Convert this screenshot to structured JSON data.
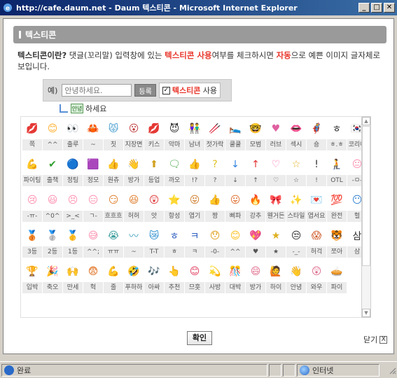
{
  "window": {
    "title": "http://cafe.daum.net - Daum 텍스티콘 - Microsoft Internet Explorer",
    "min_label": "_",
    "max_label": "□",
    "close_label": "✕"
  },
  "panel": {
    "title": "텍스티콘",
    "intro_q": "텍스티콘이란?",
    "intro_1": " 댓글(꼬리말) 입력창에 있는 ",
    "intro_r1": "텍스티콘 사용",
    "intro_2": "여부를 체크하시면 ",
    "intro_r2": "자동",
    "intro_3": "으로 예쁜 이미지 글자체로 보입니다."
  },
  "demo": {
    "example_label": "예)",
    "input_value": "안녕하세요.",
    "register_label": "등록",
    "checkbox_mark": "✓",
    "use_red": "텍스티콘",
    "use_rest": " 사용",
    "preview_pic": "안녕",
    "preview_text": "하세요"
  },
  "emoticons": [
    {
      "label": "쪽",
      "icon": "💋",
      "color": "#ff6fa0"
    },
    {
      "label": "^^",
      "icon": "😊",
      "color": "#ffb030"
    },
    {
      "label": "출루",
      "icon": "👀",
      "color": "#8a6a2a"
    },
    {
      "label": "~",
      "icon": "🦀",
      "color": "#e0502a"
    },
    {
      "label": "칫",
      "icon": "😾",
      "color": "#4aa0d0"
    },
    {
      "label": "지장면",
      "icon": "😮",
      "color": "#c04040"
    },
    {
      "label": "키스",
      "icon": "💋",
      "color": "#e02020"
    },
    {
      "label": "악마",
      "icon": "😈",
      "color": "#333333"
    },
    {
      "label": "남녀",
      "icon": "👫",
      "color": "#d07030"
    },
    {
      "label": "젓가락",
      "icon": "🥢",
      "color": "#c08040"
    },
    {
      "label": "쿨쿨",
      "icon": "🛌",
      "color": "#e0a060"
    },
    {
      "label": "모범",
      "icon": "🤓",
      "color": "#b07050"
    },
    {
      "label": "러브",
      "icon": "♥",
      "color": "#e060a0"
    },
    {
      "label": "섹시",
      "icon": "👄",
      "color": "#e02040"
    },
    {
      "label": "숑",
      "icon": "🦸",
      "color": "#c03030"
    },
    {
      "label": "ㅎ.ㅎ",
      "icon": "ㅎ",
      "color": "#333333"
    },
    {
      "label": "코리아",
      "icon": "🇰🇷",
      "color": "#2050c0"
    },
    {
      "label": "파이팅",
      "icon": "💪",
      "color": "#d04080"
    },
    {
      "label": "출책",
      "icon": "✔",
      "color": "#30a030"
    },
    {
      "label": "정팅",
      "icon": "🔵",
      "color": "#3070d0"
    },
    {
      "label": "정모",
      "icon": "🟪",
      "color": "#8040c0"
    },
    {
      "label": "원츄",
      "icon": "👍",
      "color": "#e04040"
    },
    {
      "label": "방가",
      "icon": "👋",
      "color": "#e07090"
    },
    {
      "label": "등업",
      "icon": "⬆",
      "color": "#d0a020"
    },
    {
      "label": "까오",
      "icon": "🗨",
      "color": "#40a040"
    },
    {
      "label": "!?",
      "icon": "👍",
      "color": "#e0a020"
    },
    {
      "label": "?",
      "icon": "?",
      "color": "#e0c020"
    },
    {
      "label": "↓",
      "icon": "↓",
      "color": "#3080e0"
    },
    {
      "label": "↑",
      "icon": "↑",
      "color": "#e03030"
    },
    {
      "label": "♡",
      "icon": "♡",
      "color": "#ff70b0"
    },
    {
      "label": "☆",
      "icon": "☆",
      "color": "#e0b020"
    },
    {
      "label": "!",
      "icon": "!",
      "color": "#333333"
    },
    {
      "label": "OTL",
      "icon": "🧎",
      "color": "#3050a0"
    },
    {
      "label": "-ㅁ-",
      "icon": "😐",
      "color": "#ff90b0"
    },
    {
      "label": "-ㅠ-",
      "icon": "😢",
      "color": "#ff90b0"
    },
    {
      "label": "^0^",
      "icon": "😃",
      "color": "#ff90b0"
    },
    {
      "label": ">_<",
      "icon": "😣",
      "color": "#ff90b0"
    },
    {
      "label": "ㄱ-",
      "icon": "😑",
      "color": "#ff90b0"
    },
    {
      "label": "흐흐흐",
      "icon": "😏",
      "color": "#e08030"
    },
    {
      "label": "허허",
      "icon": "😆",
      "color": "#e08030"
    },
    {
      "label": "앗",
      "icon": "😲",
      "color": "#e04040"
    },
    {
      "label": "항성",
      "icon": "⭐",
      "color": "#333333"
    },
    {
      "label": "엽기",
      "icon": "😝",
      "color": "#d08030"
    },
    {
      "label": "짱",
      "icon": "👍",
      "color": "#ff70c0"
    },
    {
      "label": "삐파",
      "icon": "😛",
      "color": "#e07030"
    },
    {
      "label": "강추",
      "icon": "🔥",
      "color": "#e02060"
    },
    {
      "label": "웬거든",
      "icon": "🎀",
      "color": "#e04080"
    },
    {
      "label": "스타일",
      "icon": "✨",
      "color": "#e04080"
    },
    {
      "label": "엽서요",
      "icon": "💌",
      "color": "#e04080"
    },
    {
      "label": "완전",
      "icon": "💯",
      "color": "#e06020"
    },
    {
      "label": "헐",
      "icon": "😶",
      "color": "#3080d0"
    },
    {
      "label": "3등",
      "icon": "🥉",
      "color": "#806040"
    },
    {
      "label": "2등",
      "icon": "🥈",
      "color": "#404040"
    },
    {
      "label": "1등",
      "icon": "🥇",
      "color": "#e0a020"
    },
    {
      "label": "^^;",
      "icon": "😅",
      "color": "#ff90b0"
    },
    {
      "label": "ㅠㅠ",
      "icon": "😭",
      "color": "#40a0a0"
    },
    {
      "label": "~",
      "icon": "〰",
      "color": "#40a0c0"
    },
    {
      "label": "T-T",
      "icon": "😿",
      "color": "#3090d0"
    },
    {
      "label": "ㅎ",
      "icon": "ㅎ",
      "color": "#3060c0"
    },
    {
      "label": "ㅋ",
      "icon": "ㅋ",
      "color": "#3060c0"
    },
    {
      "label": "-0-",
      "icon": "😯",
      "color": "#e0a020"
    },
    {
      "label": "^^",
      "icon": "😊",
      "color": "#ffc020"
    },
    {
      "label": "♥",
      "icon": "💖",
      "color": "#ff60a0"
    },
    {
      "label": "★",
      "icon": "★",
      "color": "#e0b020"
    },
    {
      "label": "-_-",
      "icon": "😒",
      "color": "#333333"
    },
    {
      "label": "허걱",
      "icon": "😱",
      "color": "#d06030"
    },
    {
      "label": "쪼아",
      "icon": "🐯",
      "color": "#e07020"
    },
    {
      "label": "삼",
      "icon": "삼",
      "color": "#333333"
    },
    {
      "label": "입박",
      "icon": "🏆",
      "color": "#c04020"
    },
    {
      "label": "축오",
      "icon": "🎉",
      "color": "#e04040"
    },
    {
      "label": "만세",
      "icon": "🙌",
      "color": "#e07020"
    },
    {
      "label": "헉",
      "icon": "😨",
      "color": "#e07020"
    },
    {
      "label": "줄",
      "icon": "💪",
      "color": "#e03030"
    },
    {
      "label": "푸하하",
      "icon": "🤣",
      "color": "#e04060"
    },
    {
      "label": "아싸",
      "icon": "🎶",
      "color": "#30a060"
    },
    {
      "label": "추천",
      "icon": "👆",
      "color": "#e02060"
    },
    {
      "label": "므흣",
      "icon": "😊",
      "color": "#e04060"
    },
    {
      "label": "사방",
      "icon": "💫",
      "color": "#c040c0"
    },
    {
      "label": "대박",
      "icon": "🎊",
      "color": "#e02020"
    },
    {
      "label": "방가",
      "icon": "😄",
      "color": "#e07090"
    },
    {
      "label": "하이",
      "icon": "🙋",
      "color": "#e07090"
    },
    {
      "label": "안녕",
      "icon": "👋",
      "color": "#40a040"
    },
    {
      "label": "와우",
      "icon": "😲",
      "color": "#e07090"
    },
    {
      "label": "파이",
      "icon": "🥧",
      "color": "#30a0a0"
    }
  ],
  "footer": {
    "ok_label": "확인",
    "close_label": "닫기",
    "close_x": "X"
  },
  "status": {
    "text": "완료",
    "zone": "인터넷"
  }
}
